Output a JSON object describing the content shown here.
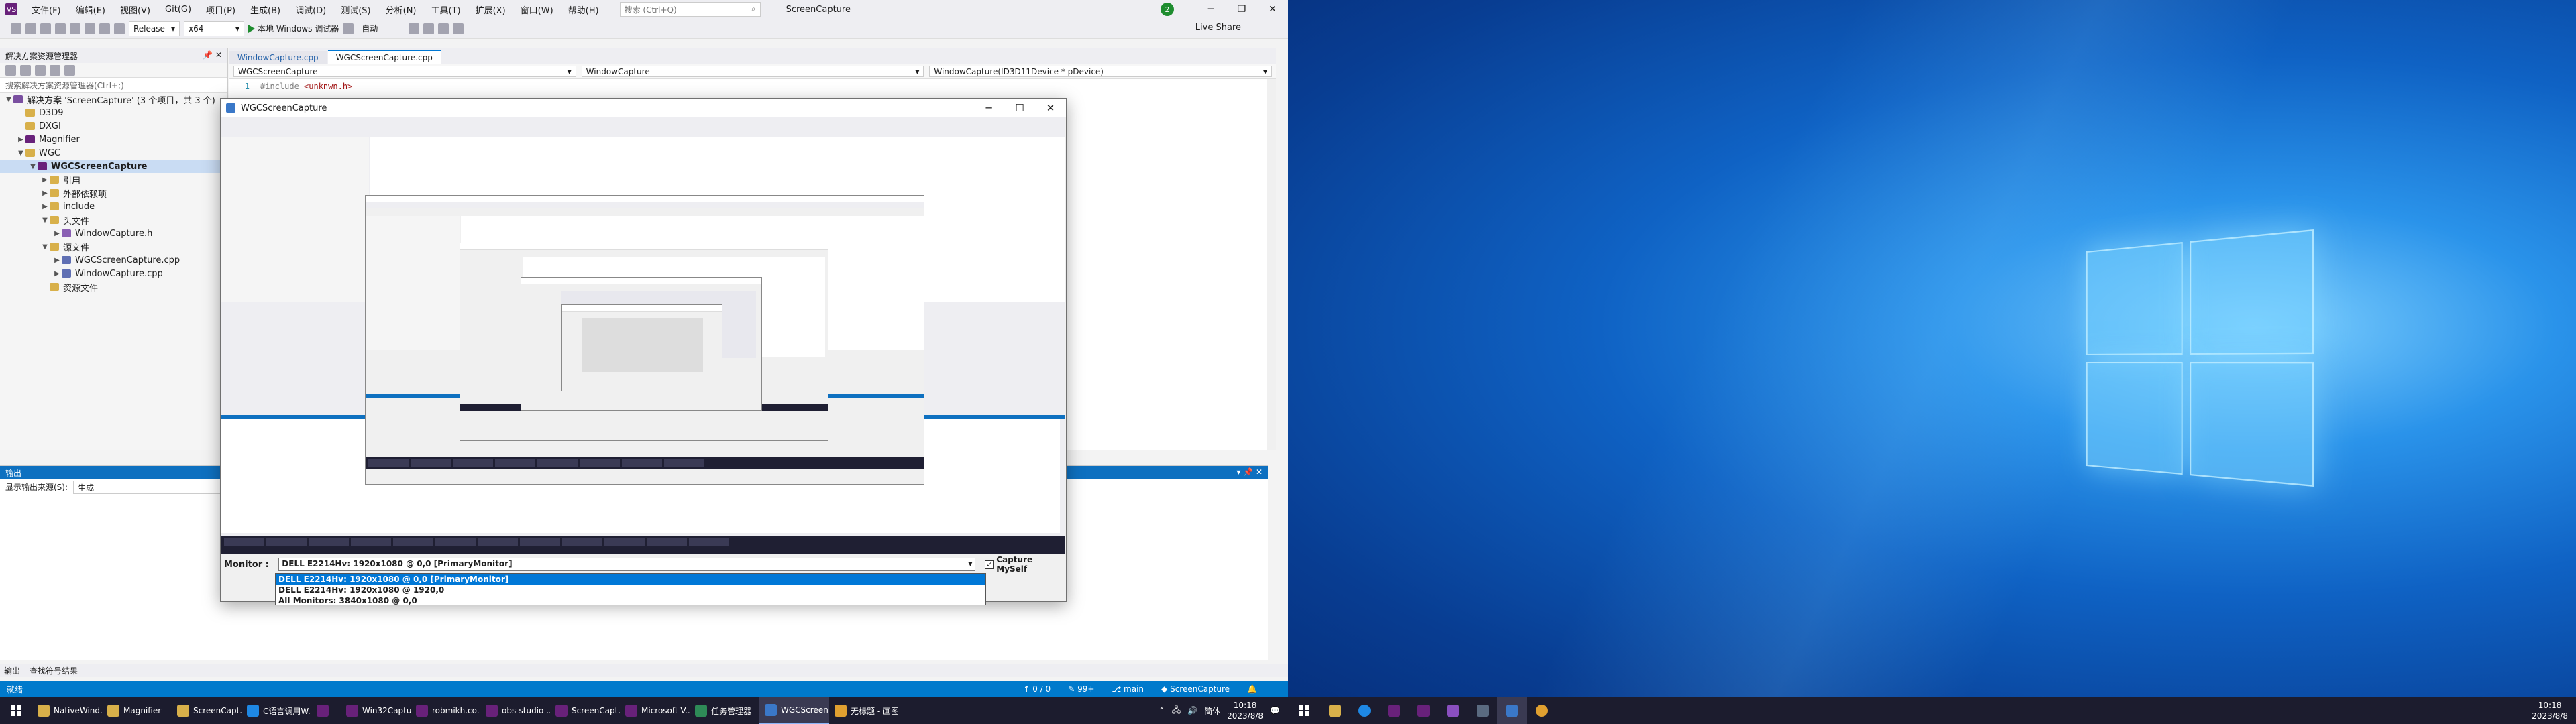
{
  "vs": {
    "menu": [
      "文件(F)",
      "编辑(E)",
      "视图(V)",
      "Git(G)",
      "项目(P)",
      "生成(B)",
      "调试(D)",
      "测试(S)",
      "分析(N)",
      "工具(T)",
      "扩展(X)",
      "窗口(W)",
      "帮助(H)"
    ],
    "search_placeholder": "搜索 (Ctrl+Q)",
    "app_title": "ScreenCapture",
    "config": "Release",
    "platform": "x64",
    "run_label": "本地 Windows 调试器",
    "auto_label": "自动",
    "live_share": "Live Share",
    "solution_explorer": {
      "title": "解决方案资源管理器",
      "search_placeholder": "搜索解决方案资源管理器(Ctrl+;)",
      "items": [
        {
          "label": "解决方案 'ScreenCapture' (3 个项目，共 3 个)",
          "indent": 0,
          "icon": "sol",
          "arrow": "▼"
        },
        {
          "label": "D3D9",
          "indent": 1,
          "icon": "folder",
          "arrow": ""
        },
        {
          "label": "DXGI",
          "indent": 1,
          "icon": "folder",
          "arrow": ""
        },
        {
          "label": "Magnifier",
          "indent": 1,
          "icon": "proj",
          "arrow": "▶"
        },
        {
          "label": "WGC",
          "indent": 1,
          "icon": "folder",
          "arrow": "▼"
        },
        {
          "label": "WGCScreenCapture",
          "indent": 2,
          "icon": "proj",
          "arrow": "▼",
          "selected": true
        },
        {
          "label": "引用",
          "indent": 3,
          "icon": "folder",
          "arrow": "▶"
        },
        {
          "label": "外部依赖项",
          "indent": 3,
          "icon": "folder",
          "arrow": "▶"
        },
        {
          "label": "include",
          "indent": 3,
          "icon": "folder",
          "arrow": "▶"
        },
        {
          "label": "头文件",
          "indent": 3,
          "icon": "folder",
          "arrow": "▼"
        },
        {
          "label": "WindowCapture.h",
          "indent": 4,
          "icon": "hdr",
          "arrow": "▶"
        },
        {
          "label": "源文件",
          "indent": 3,
          "icon": "folder",
          "arrow": "▼"
        },
        {
          "label": "WGCScreenCapture.cpp",
          "indent": 4,
          "icon": "cpp",
          "arrow": "▶"
        },
        {
          "label": "WindowCapture.cpp",
          "indent": 4,
          "icon": "cpp",
          "arrow": "▶"
        },
        {
          "label": "资源文件",
          "indent": 3,
          "icon": "folder",
          "arrow": ""
        }
      ]
    },
    "tabs": [
      "WindowCapture.cpp",
      "WGCScreenCapture.cpp"
    ],
    "nav": [
      "WGCScreenCapture",
      "WindowCapture",
      "WindowCapture(ID3D11Device * pDevice)"
    ],
    "code_line_number": "1",
    "code_line": {
      "kw": "#include",
      "str": "<unknwn.h>"
    },
    "output": {
      "title": "输出",
      "source_label": "显示输出来源(S):",
      "source_value": "生成"
    },
    "bottom_tabs": [
      "输出",
      "查找符号结果"
    ],
    "status": {
      "left": "就绪",
      "errors": "0 / 0",
      "pct": "99+",
      "branch": "main",
      "project": "ScreenCapture"
    }
  },
  "wgc": {
    "title": "WGCScreenCapture",
    "monitor_label": "Monitor :",
    "monitor_selected": "DELL E2214Hv: 1920x1080 @ 0,0 [PrimaryMonitor]",
    "capture_myself": "Capture MySelf",
    "capture_checked": "✓",
    "options": [
      "DELL E2214Hv: 1920x1080 @ 0,0 [PrimaryMonitor]",
      "DELL E2214Hv: 1920x1080 @ 1920,0",
      "All Monitors: 3840x1080 @ 0,0"
    ]
  },
  "taskbar": {
    "apps": [
      {
        "label": "NativeWind...",
        "color": "#d8b04a"
      },
      {
        "label": "Magnifier",
        "color": "#d8b04a"
      },
      {
        "label": "ScreenCapt...",
        "color": "#d8b04a"
      },
      {
        "label": "C语言调用W...",
        "color": "#1e88e5"
      },
      {
        "label": "",
        "color": "#68217a"
      },
      {
        "label": "Win32Captu...",
        "color": "#68217a"
      },
      {
        "label": "robmikh.co...",
        "color": "#68217a"
      },
      {
        "label": "obs-studio ...",
        "color": "#68217a"
      },
      {
        "label": "ScreenCapt...",
        "color": "#68217a"
      },
      {
        "label": "Microsoft V...",
        "color": "#68217a"
      },
      {
        "label": "任务管理器",
        "color": "#2e8b57"
      },
      {
        "label": "WGCScreen...",
        "color": "#3a78c8",
        "active": true
      },
      {
        "label": "无标题 - 画图",
        "color": "#e0a030"
      }
    ],
    "ime": "简体",
    "time": "10:18",
    "date": "2023/8/8"
  },
  "taskbar2": {
    "time": "10:18",
    "date": "2023/8/8"
  }
}
